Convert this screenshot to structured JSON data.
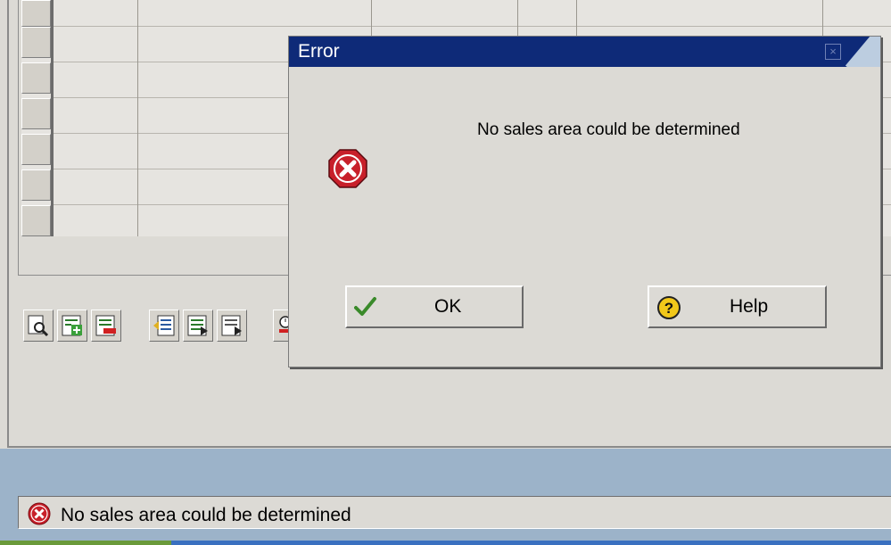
{
  "dialog": {
    "title": "Error",
    "close_glyph": "×",
    "message": "No sales area could be determined",
    "icon": "error-stop-icon",
    "ok_label": "OK",
    "help_label": "Help",
    "ok_icon": "checkmark-icon",
    "help_icon": "help-question-icon"
  },
  "status_bar": {
    "message": "No sales area could be determined",
    "icon": "error-icon"
  },
  "toolbar": {
    "buttons": [
      "details-icon",
      "add-row-icon",
      "delete-row-icon",
      "import-icon",
      "list-icon",
      "export-icon",
      "clock-icon"
    ]
  },
  "colors": {
    "titlebar": "#0e2a78",
    "background": "#dcdad5",
    "status_band": "#9cb3c9",
    "error_red": "#c8202a",
    "ok_green": "#3a8a2a"
  }
}
